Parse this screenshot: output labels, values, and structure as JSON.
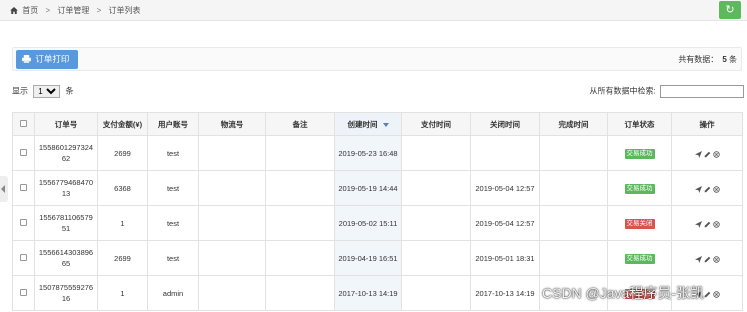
{
  "breadcrumb": {
    "home": "首页",
    "sep": ">",
    "level2": "订单管理",
    "level3": "订单列表"
  },
  "toolbar": {
    "refresh_icon": "refresh-icon",
    "print_label": "订单打印",
    "print_icon": "print-icon"
  },
  "summary": {
    "total_label": "共有数据：",
    "total_count": "5",
    "total_unit": "条"
  },
  "length_control": {
    "show_label": "显示",
    "selected": "10",
    "unit": "条"
  },
  "search": {
    "label": "从所有数据中检索:",
    "value": ""
  },
  "table": {
    "headers": [
      "",
      "订单号",
      "支付金额(¥)",
      "用户账号",
      "物流号",
      "备注",
      "创建时间",
      "支付时间",
      "关闭时间",
      "完成时间",
      "订单状态",
      "操作"
    ],
    "sorted_column": "创建时间",
    "rows": [
      {
        "order_no": "155860129732462",
        "amount": "2699",
        "user": "test",
        "logistics": "",
        "note": "",
        "created": "2019-05-23 16:48",
        "paid": "",
        "closed": "",
        "completed": "",
        "status": "交易成功",
        "status_color": "#5cb85c"
      },
      {
        "order_no": "155677946847013",
        "amount": "6368",
        "user": "test",
        "logistics": "",
        "note": "",
        "created": "2019-05-19 14:44",
        "paid": "",
        "closed": "2019-05-04 12:57",
        "completed": "",
        "status": "交易成功",
        "status_color": "#5cb85c"
      },
      {
        "order_no": "155678110657951",
        "amount": "1",
        "user": "test",
        "logistics": "",
        "note": "",
        "created": "2019-05-02 15:11",
        "paid": "",
        "closed": "2019-05-04 12:57",
        "completed": "",
        "status": "交易关闭",
        "status_color": "#d9534f"
      },
      {
        "order_no": "155661430389665",
        "amount": "2699",
        "user": "test",
        "logistics": "",
        "note": "",
        "created": "2019-04-19 16:51",
        "paid": "",
        "closed": "2019-05-01 18:31",
        "completed": "",
        "status": "交易成功",
        "status_color": "#5cb85c"
      },
      {
        "order_no": "150787555927616",
        "amount": "1",
        "user": "admin",
        "logistics": "",
        "note": "",
        "created": "2017-10-13 14:19",
        "paid": "",
        "closed": "2017-10-13 14:19",
        "completed": "",
        "status": "交易关闭",
        "status_color": "#d9534f"
      }
    ],
    "row_actions": [
      "send-icon",
      "edit-icon",
      "delete-icon"
    ]
  },
  "watermark": "CSDN @Java程序员-张凯",
  "colors": {
    "primary": "#5a98de",
    "success": "#5cb85c",
    "danger": "#d9534f",
    "refresh": "#5eb95e"
  }
}
